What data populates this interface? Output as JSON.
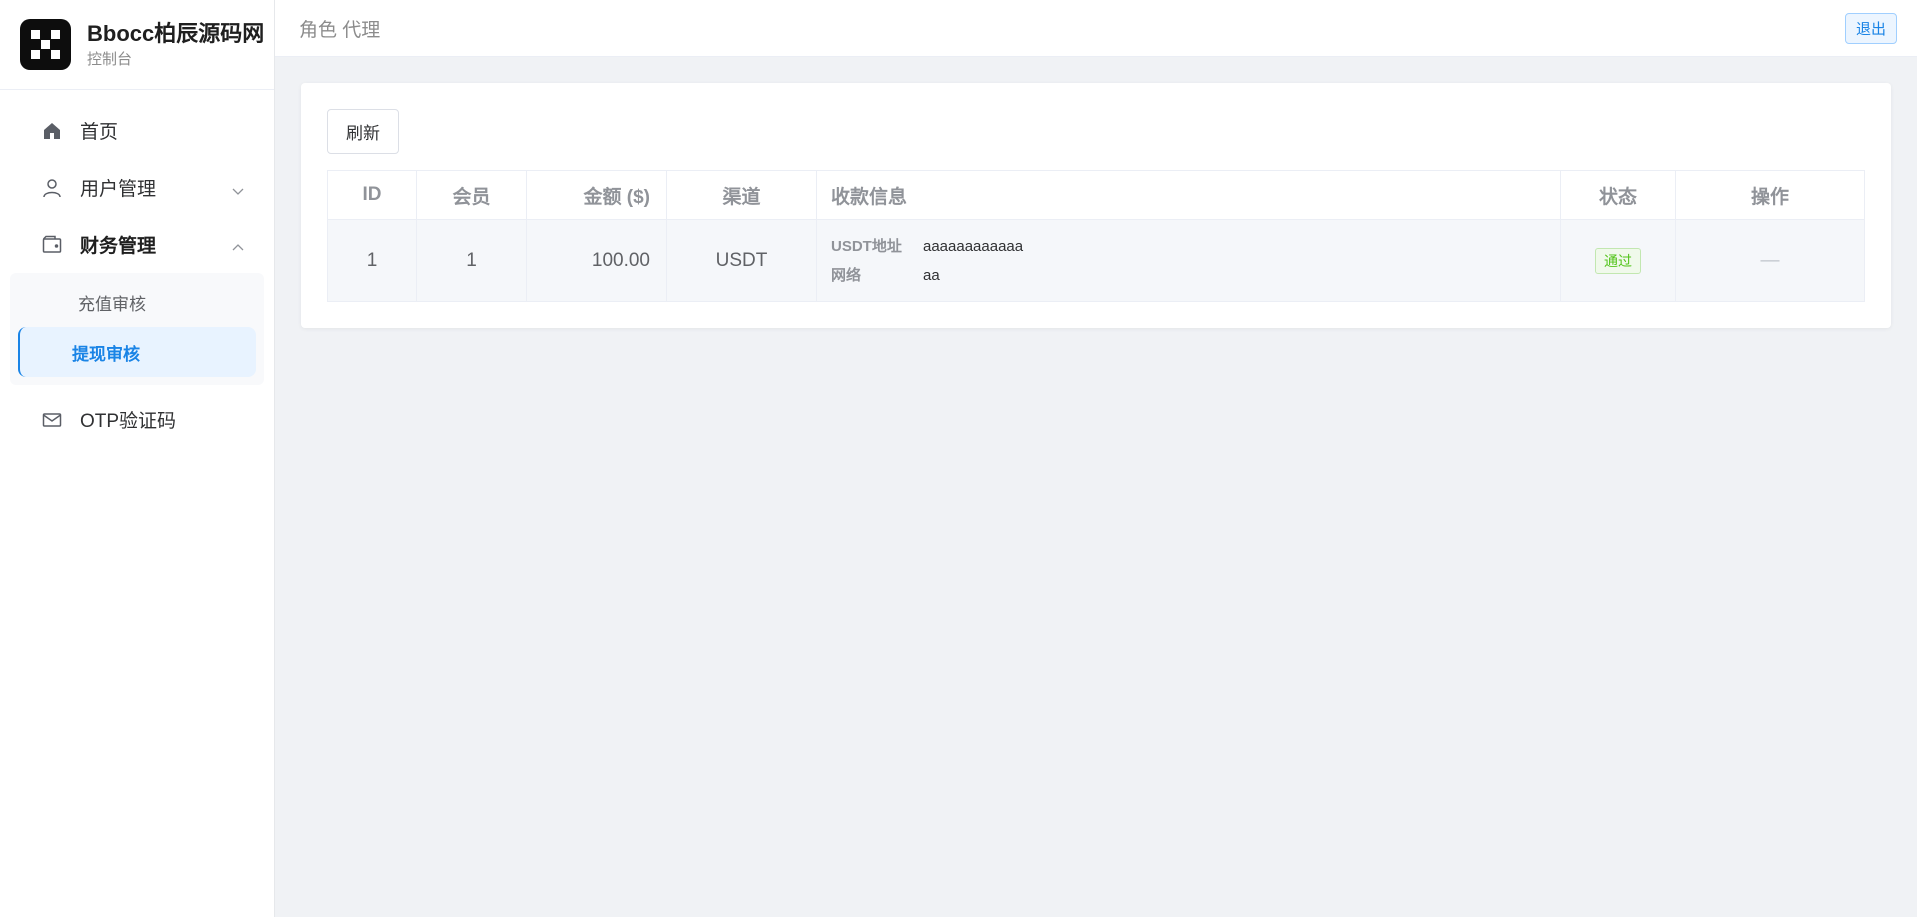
{
  "brand": {
    "title": "Bbocc柏辰源码网",
    "subtitle": "控制台"
  },
  "sidebar": {
    "items": [
      {
        "label": "首页",
        "icon": "home-icon"
      },
      {
        "label": "用户管理",
        "icon": "user-icon",
        "expanded": false
      },
      {
        "label": "财务管理",
        "icon": "wallet-icon",
        "expanded": true,
        "children": [
          {
            "label": "充值审核",
            "active": false
          },
          {
            "label": "提现审核",
            "active": true
          }
        ]
      },
      {
        "label": "OTP验证码",
        "icon": "mail-icon"
      }
    ]
  },
  "topbar": {
    "role": "角色 代理",
    "logout_label": "退出"
  },
  "toolbar": {
    "refresh_label": "刷新"
  },
  "table": {
    "headers": [
      "ID",
      "会员",
      "金额 ($)",
      "渠道",
      "收款信息",
      "状态",
      "操作"
    ],
    "rows": [
      {
        "id": "1",
        "member": "1",
        "amount": "100.00",
        "channel": "USDT",
        "payinfo": [
          {
            "key": "USDT地址",
            "value": "aaaaaaaaaaaa"
          },
          {
            "key": "网络",
            "value": "aa"
          }
        ],
        "status": "通过",
        "action": "—"
      }
    ]
  },
  "colors": {
    "accent": "#1a84e6",
    "success": "#52c41a",
    "background": "#f0f2f5"
  }
}
